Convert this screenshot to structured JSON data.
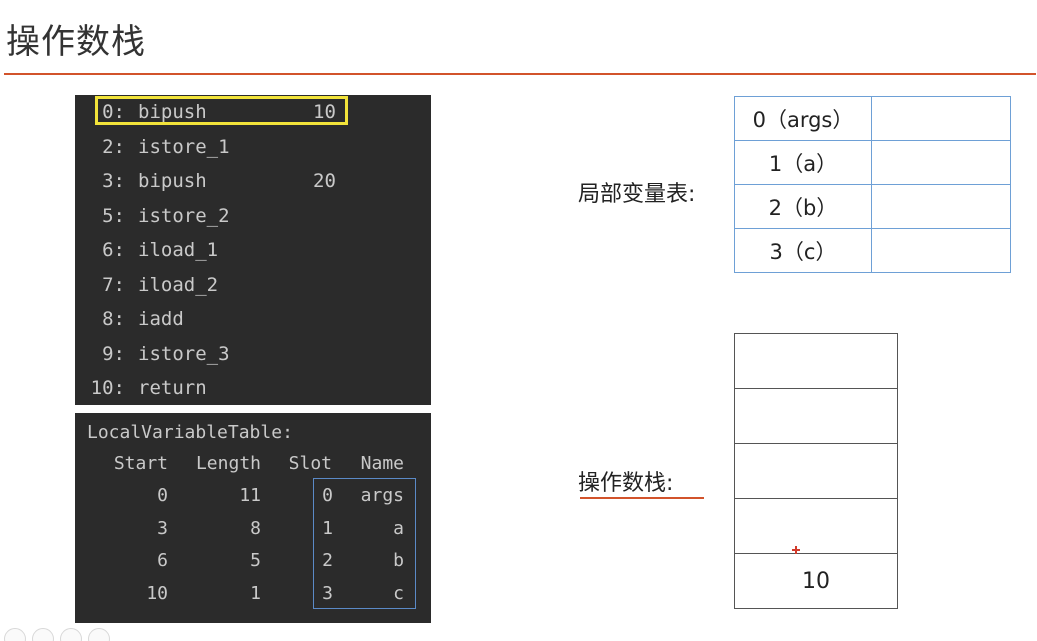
{
  "title": "操作数栈",
  "bytecode": {
    "lines": [
      {
        "idx": "0:",
        "op": "bipush",
        "arg": "10",
        "highlighted": true
      },
      {
        "idx": "2:",
        "op": "istore_1",
        "arg": ""
      },
      {
        "idx": "3:",
        "op": "bipush",
        "arg": "20"
      },
      {
        "idx": "5:",
        "op": "istore_2",
        "arg": ""
      },
      {
        "idx": "6:",
        "op": "iload_1",
        "arg": ""
      },
      {
        "idx": "7:",
        "op": "iload_2",
        "arg": ""
      },
      {
        "idx": "8:",
        "op": "iadd",
        "arg": ""
      },
      {
        "idx": "9:",
        "op": "istore_3",
        "arg": ""
      },
      {
        "idx": "10:",
        "op": "return",
        "arg": ""
      }
    ]
  },
  "local_variable_table": {
    "title": "LocalVariableTable:",
    "headers": [
      "Start",
      "Length",
      "Slot",
      "Name"
    ],
    "rows": [
      [
        "0",
        "11",
        "0",
        "args"
      ],
      [
        "3",
        "8",
        "1",
        "a"
      ],
      [
        "6",
        "5",
        "2",
        "b"
      ],
      [
        "10",
        "1",
        "3",
        "c"
      ]
    ]
  },
  "locals_diagram": {
    "label": "局部变量表:",
    "rows": [
      {
        "key": "0（args）",
        "value": ""
      },
      {
        "key": "1（a）",
        "value": ""
      },
      {
        "key": "2（b）",
        "value": ""
      },
      {
        "key": "3（c）",
        "value": ""
      }
    ]
  },
  "stack_diagram": {
    "label": "操作数栈:",
    "slots": [
      "",
      "",
      "",
      "",
      "10"
    ]
  },
  "colors": {
    "accent_rule": "#d2532b",
    "highlight": "#f2e33a",
    "table_border": "#6ea0d6",
    "code_bg": "#2b2b2b"
  }
}
